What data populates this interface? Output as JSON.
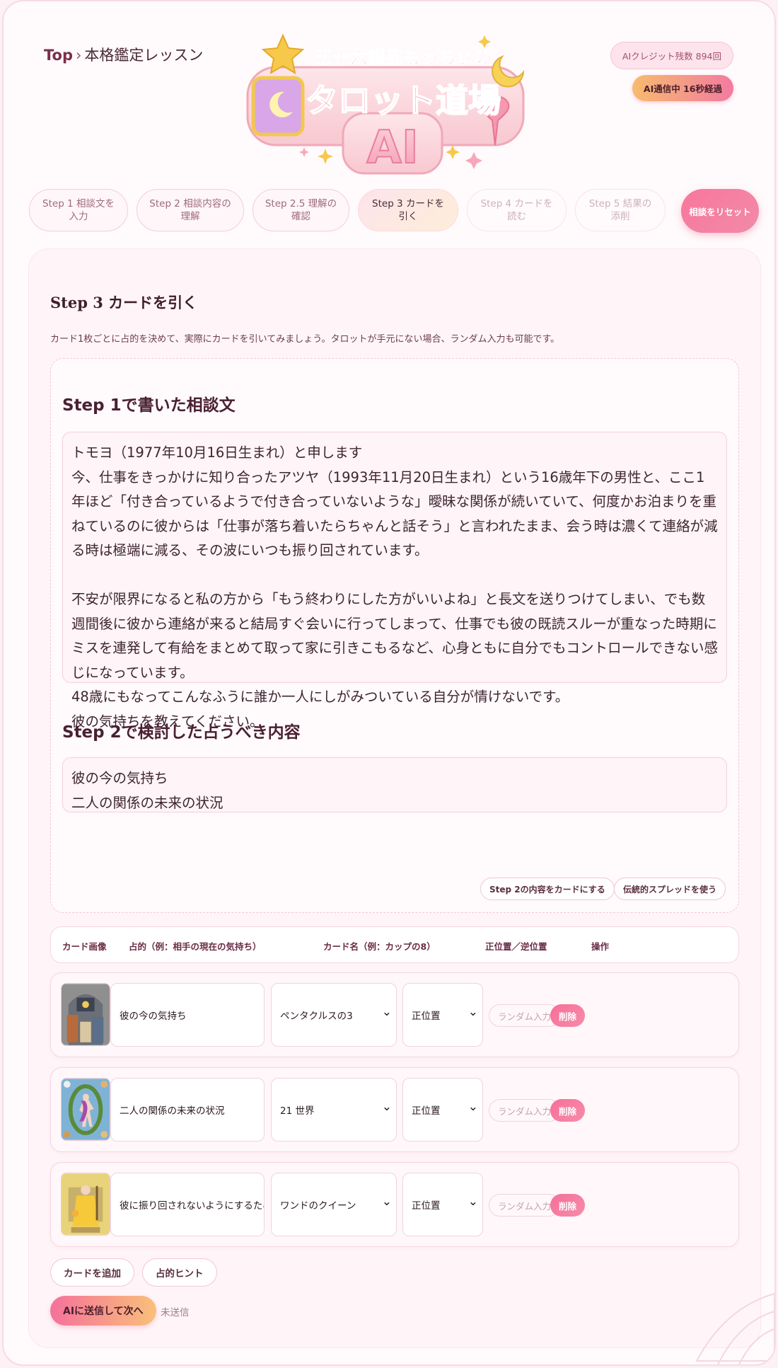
{
  "breadcrumb": {
    "top": "Top",
    "separator": "›",
    "current": "本格鑑定レッスン"
  },
  "logo": {
    "line1": "五十六謀星もっちぃの",
    "line2": "タロット道場",
    "line3": "AI"
  },
  "credit_badge": "AIクレジット残数 894回",
  "status_badge": "AI通信中 16秒経過",
  "steps": [
    {
      "label": "Step 1 相談文を\n入力",
      "state": "done"
    },
    {
      "label": "Step 2 相談内容の\n理解",
      "state": "done"
    },
    {
      "label": "Step 2.5 理解の\n確認",
      "state": "done"
    },
    {
      "label": "Step 3 カードを\n引く",
      "state": "active"
    },
    {
      "label": "Step 4 カードを\n読む",
      "state": "disabled"
    },
    {
      "label": "Step 5 結果の\n添削",
      "state": "disabled"
    }
  ],
  "reset_button": "相談をリセット",
  "section": {
    "title": "Step 3 カードを引く",
    "description": "カード1枚ごとに占的を決めて、実際にカードを引いてみましょう。タロットが手元にない場合、ランダム入力も可能です。"
  },
  "consultation": {
    "heading": "Step 1で書いた相談文",
    "text": "トモヨ（1977年10月16日生まれ）と申します\n今、仕事をきっかけに知り合ったアツヤ（1993年11月20日生まれ）という16歳年下の男性と、ここ1年ほど「付き合っているようで付き合っていないような」曖昧な関係が続いていて、何度かお泊まりを重ねているのに彼からは「仕事が落ち着いたらちゃんと話そう」と言われたまま、会う時は濃くて連絡が減る時は極端に減る、その波にいつも振り回されています。\n\n不安が限界になると私の方から「もう終わりにした方がいいよね」と長文を送りつけてしまい、でも数週間後に彼から連絡が来ると結局すぐ会いに行ってしまって、仕事でも彼の既読スルーが重なった時期にミスを連発して有給をまとめて取って家に引きこもるなど、心身ともに自分でもコントロールできない感じになっています。\n48歳にもなってこんなふうに誰か一人にしがみついている自分が情けないです。\n彼の気持ちを教えてください。",
    "topics_heading": "Step 2で検討した占うべき内容",
    "topics_text": "彼の今の気持ち\n二人の関係の未来の状況",
    "btn_step2_to_cards": "Step 2の内容をカードにする",
    "btn_traditional_spread": "伝統的スプレッドを使う"
  },
  "table": {
    "headers": {
      "image": "カード画像",
      "purpose": "占的（例：相手の現在の気持ち）",
      "card_name": "カード名（例：カップの8）",
      "orientation": "正位置／逆位置",
      "actions": "操作"
    },
    "rows": [
      {
        "purpose": "彼の今の気持ち",
        "card": "ペンタクルスの3",
        "orientation": "正位置",
        "random": "ランダム入力",
        "delete": "削除"
      },
      {
        "purpose": "二人の関係の未来の状況",
        "card": "21 世界",
        "orientation": "正位置",
        "random": "ランダム入力",
        "delete": "削除"
      },
      {
        "purpose": "彼に振り回されないようにするための行動",
        "card": "ワンドのクイーン",
        "orientation": "正位置",
        "random": "ランダム入力",
        "delete": "削除"
      }
    ]
  },
  "buttons": {
    "add_card": "カードを追加",
    "purpose_hint": "占的ヒント",
    "send": "AIに送信して次へ",
    "send_status": "未送信"
  },
  "colors": {
    "accent_pink": "#f5719b",
    "accent_orange": "#f9c07a",
    "background": "#fdf1f5"
  }
}
